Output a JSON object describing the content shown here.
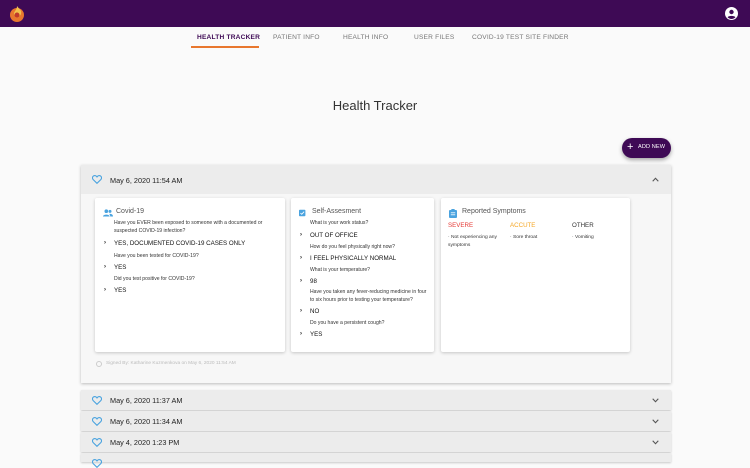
{
  "tabs": [
    "HEALTH TRACKER",
    "PATIENT INFO",
    "HEALTH INFO",
    "USER FILES",
    "COVID-19 TEST SITE FINDER"
  ],
  "page_title": "Health Tracker",
  "add_button": "ADD NEW",
  "expanded_entry": {
    "date": "May 6, 2020 11:54 AM",
    "covid": {
      "title": "Covid-19",
      "q1": "Have you EVER been exposed to someone with a documented or suspected COVID-19 infection?",
      "a1": "YES, DOCUMENTED COVID-19 CASES ONLY",
      "q2": "Have you been tested for COVID-19?",
      "a2": "YES",
      "q3": "Did you test positive for COVID-19?",
      "a3": "YES"
    },
    "self": {
      "title": "Self-Assesment",
      "q1": "What is your work status?",
      "a1": "OUT OF OFFICE",
      "q2": "How do you feel physically right now?",
      "a2": "I FEEL PHYSICALLY NORMAL",
      "q3": "What is your temperature?",
      "a3": "98",
      "q4": "Have you taken any fever-reducing medicine in four to six hours prior to testing your temperature?",
      "a4": "NO",
      "q5": "Do you have a persistent cough?",
      "a5": "YES"
    },
    "symptoms": {
      "title": "Reported Symptoms",
      "severe_label": "SEVERE",
      "severe_item": "· Not experiencing any symptoms",
      "acute_label": "ACCUTE",
      "acute_item": "· Sore throat",
      "other_label": "OTHER",
      "other_item": "· Vomiting"
    },
    "signed": "Signed By: Katharine Kuzmenkova on May 6, 2020 11:54 AM"
  },
  "collapsed_entries": [
    "May 6, 2020 11:37 AM",
    "May 6, 2020 11:34 AM",
    "May 4, 2020 1:23 PM"
  ],
  "colors": {
    "brand": "#3e0a55",
    "accent": "#e8772e",
    "heart": "#4aa3df",
    "severe": "#e53935",
    "acute": "#f5a623"
  }
}
